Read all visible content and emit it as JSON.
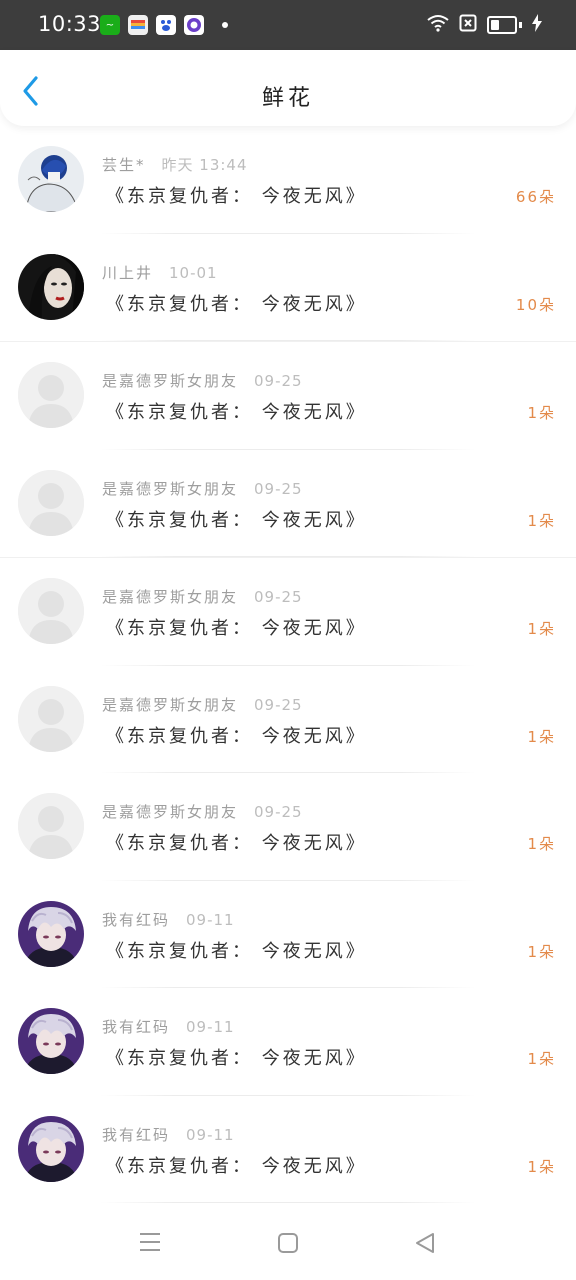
{
  "status": {
    "time": "10:33"
  },
  "header": {
    "title": "鲜花"
  },
  "rows": [
    {
      "name": "芸生*",
      "time": "昨天 13:44",
      "work": "《东京复仇者： 今夜无风》",
      "count": "66朵",
      "avatar": "avatar-blue-boy"
    },
    {
      "name": "川上井",
      "time": "10-01",
      "work": "《东京复仇者： 今夜无风》",
      "count": "10朵",
      "avatar": "avatar-dark-woman"
    },
    {
      "name": "是嘉德罗斯女朋友",
      "time": "09-25",
      "work": "《东京复仇者： 今夜无风》",
      "count": "1朵",
      "avatar": "avatar-placeholder"
    },
    {
      "name": "是嘉德罗斯女朋友",
      "time": "09-25",
      "work": "《东京复仇者： 今夜无风》",
      "count": "1朵",
      "avatar": "avatar-placeholder"
    },
    {
      "name": "是嘉德罗斯女朋友",
      "time": "09-25",
      "work": "《东京复仇者： 今夜无风》",
      "count": "1朵",
      "avatar": "avatar-placeholder"
    },
    {
      "name": "是嘉德罗斯女朋友",
      "time": "09-25",
      "work": "《东京复仇者： 今夜无风》",
      "count": "1朵",
      "avatar": "avatar-placeholder"
    },
    {
      "name": "是嘉德罗斯女朋友",
      "time": "09-25",
      "work": "《东京复仇者： 今夜无风》",
      "count": "1朵",
      "avatar": "avatar-placeholder"
    },
    {
      "name": "我有红码",
      "time": "09-11",
      "work": "《东京复仇者： 今夜无风》",
      "count": "1朵",
      "avatar": "avatar-white-hair"
    },
    {
      "name": "我有红码",
      "time": "09-11",
      "work": "《东京复仇者： 今夜无风》",
      "count": "1朵",
      "avatar": "avatar-white-hair"
    },
    {
      "name": "我有红码",
      "time": "09-11",
      "work": "《东京复仇者： 今夜无风》",
      "count": "1朵",
      "avatar": "avatar-white-hair"
    }
  ],
  "colors": {
    "accent_back": "#1e9ae6",
    "count": "#e38a4a",
    "status_bar": "#3d3d3d"
  },
  "icons": {
    "back": "chevron-left-icon",
    "nav_menu": "menu-icon",
    "nav_home": "square-home-icon",
    "nav_back": "triangle-back-icon",
    "wifi": "wifi-icon",
    "battery": "battery-icon",
    "charging": "lightning-icon",
    "sim": "sim-x-icon"
  }
}
